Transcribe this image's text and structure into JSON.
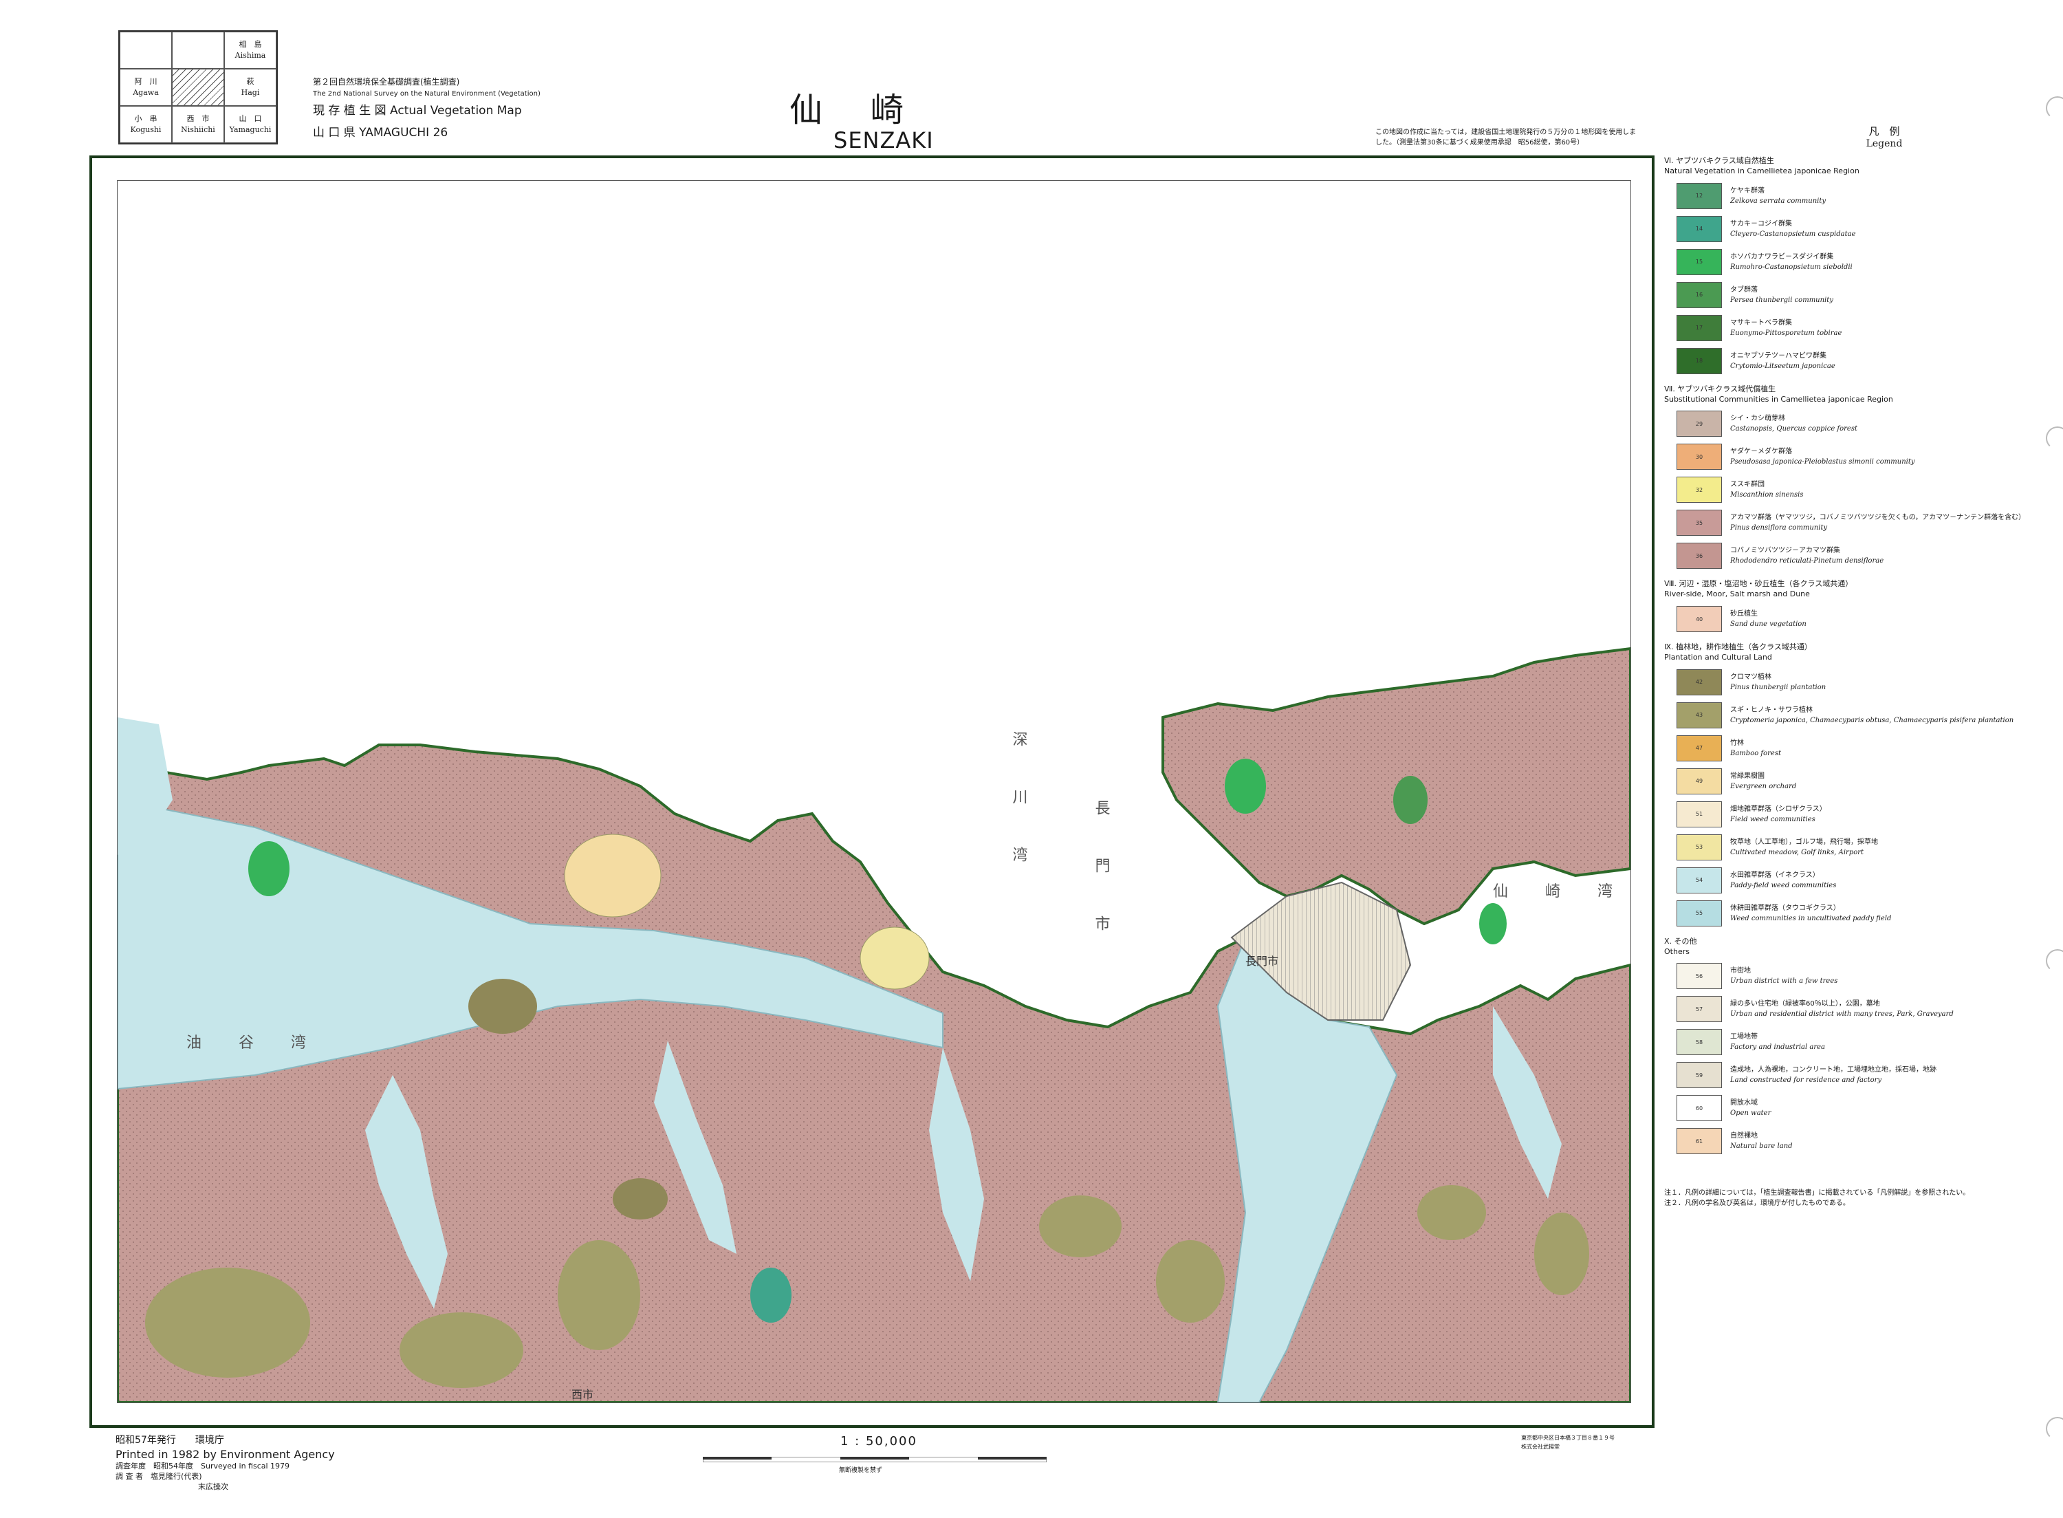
{
  "index_map": {
    "cells": [
      {
        "jp": "",
        "en": ""
      },
      {
        "jp": "",
        "en": ""
      },
      {
        "jp": "相　島",
        "en": "Aishima"
      },
      {
        "jp": "阿　川",
        "en": "Agawa"
      },
      {
        "jp": "",
        "en": ""
      },
      {
        "jp": "萩",
        "en": "Hagi"
      },
      {
        "jp": "小　串",
        "en": "Kogushi"
      },
      {
        "jp": "西　市",
        "en": "Nishiichi"
      },
      {
        "jp": "山　口",
        "en": "Yamaguchi"
      }
    ]
  },
  "survey": {
    "line1": "第２回自然環境保全基礎調査(植生調査)",
    "line2": "The 2nd National Survey on the Natural Environment (Vegetation)",
    "line3_jp": "現 存 植 生 図",
    "line3_en": "Actual Vegetation Map",
    "line4": "山 口 県  YAMAGUCHI 26"
  },
  "title": {
    "jp": "仙崎",
    "en": "SENZAKI"
  },
  "top_note": "この地図の作成に当たっては，建設省国土地理院発行の５万分の１地形図を使用しました。（測量法第30条に基づく成果使用承認　昭56総使，第60号）",
  "legend": {
    "title_jp": "凡　例",
    "title_en": "Legend",
    "groups": [
      {
        "heading_jp": "Ⅵ. ヤブツバキクラス域自然植生",
        "heading_en": "Natural Vegetation in Camellietea japonicae Region",
        "items": [
          {
            "code": "12",
            "color": "#4f9c70",
            "jp": "ケヤキ群落",
            "en": "Zelkova serrata community"
          },
          {
            "code": "14",
            "color": "#3fa58c",
            "jp": "サカキ－コジイ群集",
            "en": "Cleyero-Castanopsietum cuspidatae"
          },
          {
            "code": "15",
            "color": "#36b45a",
            "jp": "ホソバカナワラビ－スダジイ群集",
            "en": "Rumohro-Castanopsietum sieboldii"
          },
          {
            "code": "16",
            "color": "#4b9a52",
            "jp": "タブ群落",
            "en": "Persea thunbergii community"
          },
          {
            "code": "17",
            "color": "#3f7d3a",
            "jp": "マサキ－トベラ群集",
            "en": "Euonymo-Pittosporetum tobirae"
          },
          {
            "code": "18",
            "color": "#2f6e2a",
            "jp": "オニヤブソテツ－ハマビワ群集",
            "en": "Crytomio-Litseetum japonicae"
          }
        ]
      },
      {
        "heading_jp": "Ⅶ. ヤブツバキクラス域代償植生",
        "heading_en": "Substitutional Communities in Camellietea japonicae Region",
        "items": [
          {
            "code": "29",
            "color": "#c9b4a8",
            "jp": "シイ・カシ萌芽林",
            "en": "Castanopsis, Quercus coppice forest"
          },
          {
            "code": "30",
            "color": "#eeae78",
            "jp": "ヤダケ－メダケ群落",
            "en": "Pseudosasa japonica-Pleioblastus simonii community"
          },
          {
            "code": "32",
            "color": "#f3ec8c",
            "jp": "ススキ群団",
            "en": "Miscanthion sinensis"
          },
          {
            "code": "35",
            "color": "#c89b98",
            "jp": "アカマツ群落（ヤマツツジ，コバノミツバツツジを欠くもの，アカマツ－ナンテン群落を含む）",
            "en": "Pinus densiflora community"
          },
          {
            "code": "36",
            "color": "#c39691",
            "jp": "コバノミツバツツジ－アカマツ群集",
            "en": "Rhododendro reticulati-Pinetum densiflorae"
          }
        ]
      },
      {
        "heading_jp": "Ⅷ. 河辺・湿原・塩沼地・砂丘植生（各クラス域共通）",
        "heading_en": "River-side, Moor, Salt marsh and Dune",
        "items": [
          {
            "code": "40",
            "color": "#f2cdb8",
            "jp": "砂丘植生",
            "en": "Sand dune vegetation"
          }
        ]
      },
      {
        "heading_jp": "Ⅸ. 植林地，耕作地植生（各クラス域共通）",
        "heading_en": "Plantation and Cultural Land",
        "items": [
          {
            "code": "42",
            "color": "#8f8858",
            "jp": "クロマツ植林",
            "en": "Pinus thunbergii plantation"
          },
          {
            "code": "43",
            "color": "#a3a06a",
            "jp": "スギ・ヒノキ・サワラ植林",
            "en": "Cryptomeria japonica, Chamaecyparis obtusa, Chamaecyparis pisifera plantation"
          },
          {
            "code": "47",
            "color": "#e8b055",
            "jp": "竹林",
            "en": "Bamboo forest"
          },
          {
            "code": "49",
            "color": "#f4dca2",
            "jp": "常緑果樹園",
            "en": "Evergreen orchard"
          },
          {
            "code": "51",
            "color": "#f6ead0",
            "jp": "畑地雑草群落（シロザクラス）",
            "en": "Field weed communities"
          },
          {
            "code": "53",
            "color": "#f1e6a2",
            "jp": "牧草地（人工草地），ゴルフ場，飛行場，採草地",
            "en": "Cultivated meadow, Golf links, Airport"
          },
          {
            "code": "54",
            "color": "#c6e6ea",
            "jp": "水田雑草群落（イネクラス）",
            "en": "Paddy-field weed communities"
          },
          {
            "code": "55",
            "color": "#b5dde2",
            "jp": "休耕田雑草群落（タウコギクラス）",
            "en": "Weed communities in uncultivated paddy field"
          }
        ]
      },
      {
        "heading_jp": "Ⅹ. その他",
        "heading_en": "Others",
        "items": [
          {
            "code": "56",
            "color": "#f7f4ea",
            "jp": "市街地",
            "en": "Urban district with a few trees"
          },
          {
            "code": "57",
            "color": "#ebe4d4",
            "jp": "緑の多い住宅地（緑被率60％以上），公園，墓地",
            "en": "Urban and residential district with many trees, Park, Graveyard"
          },
          {
            "code": "58",
            "color": "#dfe6d2",
            "jp": "工場地帯",
            "en": "Factory and industrial area"
          },
          {
            "code": "59",
            "color": "#e6e0d0",
            "jp": "造成地，人為裸地，コンクリート地，工場埋地立地，採石場，地跡",
            "en": "Land constructed for residence and factory"
          },
          {
            "code": "60",
            "color": "#ffffff",
            "jp": "開放水域",
            "en": "Open water"
          },
          {
            "code": "61",
            "color": "#f5d6b6",
            "jp": "自然裸地",
            "en": "Natural bare land"
          }
        ]
      }
    ],
    "note1": "注１．凡例の詳細については，「植生調査報告書」に掲載されている「凡例解説」を参照されたい。",
    "note2": "注２．凡例の学名及び英名は，環境庁が付したものである。"
  },
  "map_labels": {
    "water1": "仙　崎　湾",
    "water2": "深　川　湾",
    "water3": "長　門　市",
    "water4": "油　谷　湾",
    "town1": "長門市",
    "bottom_city": "西市"
  },
  "footer": {
    "issue_jp": "昭和57年発行　　環境庁",
    "issue_en": "Printed in 1982 by Environment Agency",
    "survey_year": "調査年度　昭和54年度　Surveyed in fiscal 1979",
    "surveyor": "調 査 者　塩見隆行(代表)",
    "surveyor2": "末広操次",
    "scale": "1 : 50,000",
    "scale_note": "無断複製を禁ず",
    "printer1": "東京都中央区日本橋３丁目８番１９号",
    "printer2": "株式会社武揚堂"
  }
}
